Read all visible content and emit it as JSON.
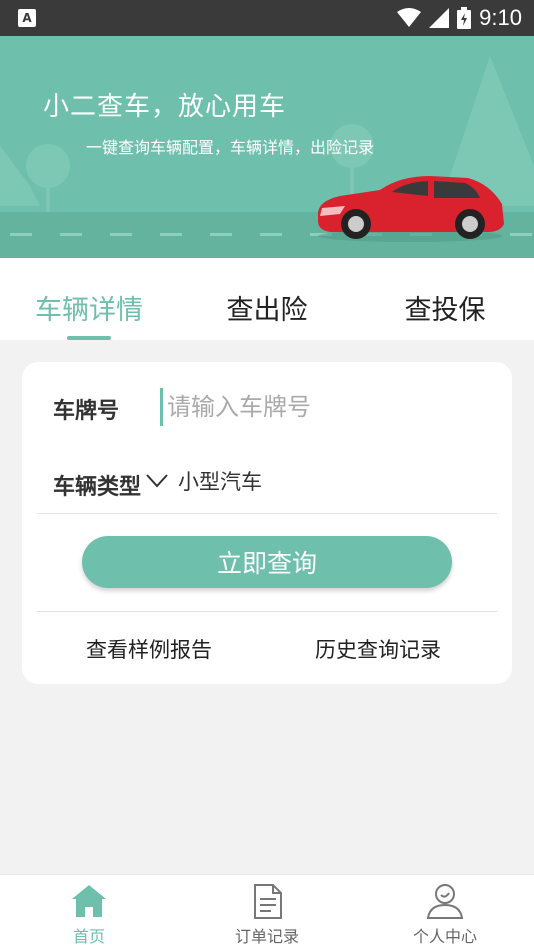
{
  "status_bar": {
    "app_icon_letter": "A",
    "time": "9:10"
  },
  "banner": {
    "title": "小二查车，放心用车",
    "subtitle": "一键查询车辆配置，车辆详情，出险记录"
  },
  "tabs": [
    {
      "label": "车辆详情",
      "active": true
    },
    {
      "label": "查出险",
      "active": false
    },
    {
      "label": "查投保",
      "active": false
    }
  ],
  "form": {
    "plate_label": "车牌号",
    "plate_placeholder": "请输入车牌号",
    "plate_value": "",
    "type_label": "车辆类型",
    "type_value": "小型汽车",
    "submit_label": "立即查询",
    "sample_report_label": "查看样例报告",
    "history_label": "历史查询记录"
  },
  "bottom_nav": [
    {
      "label": "首页",
      "icon": "home-icon",
      "active": true
    },
    {
      "label": "订单记录",
      "icon": "document-icon",
      "active": false
    },
    {
      "label": "个人中心",
      "icon": "user-icon",
      "active": false
    }
  ],
  "colors": {
    "accent": "#6ec0ac",
    "car_red": "#d9222e",
    "status_bar": "#3a3a3a",
    "background": "#f2f2f2"
  }
}
